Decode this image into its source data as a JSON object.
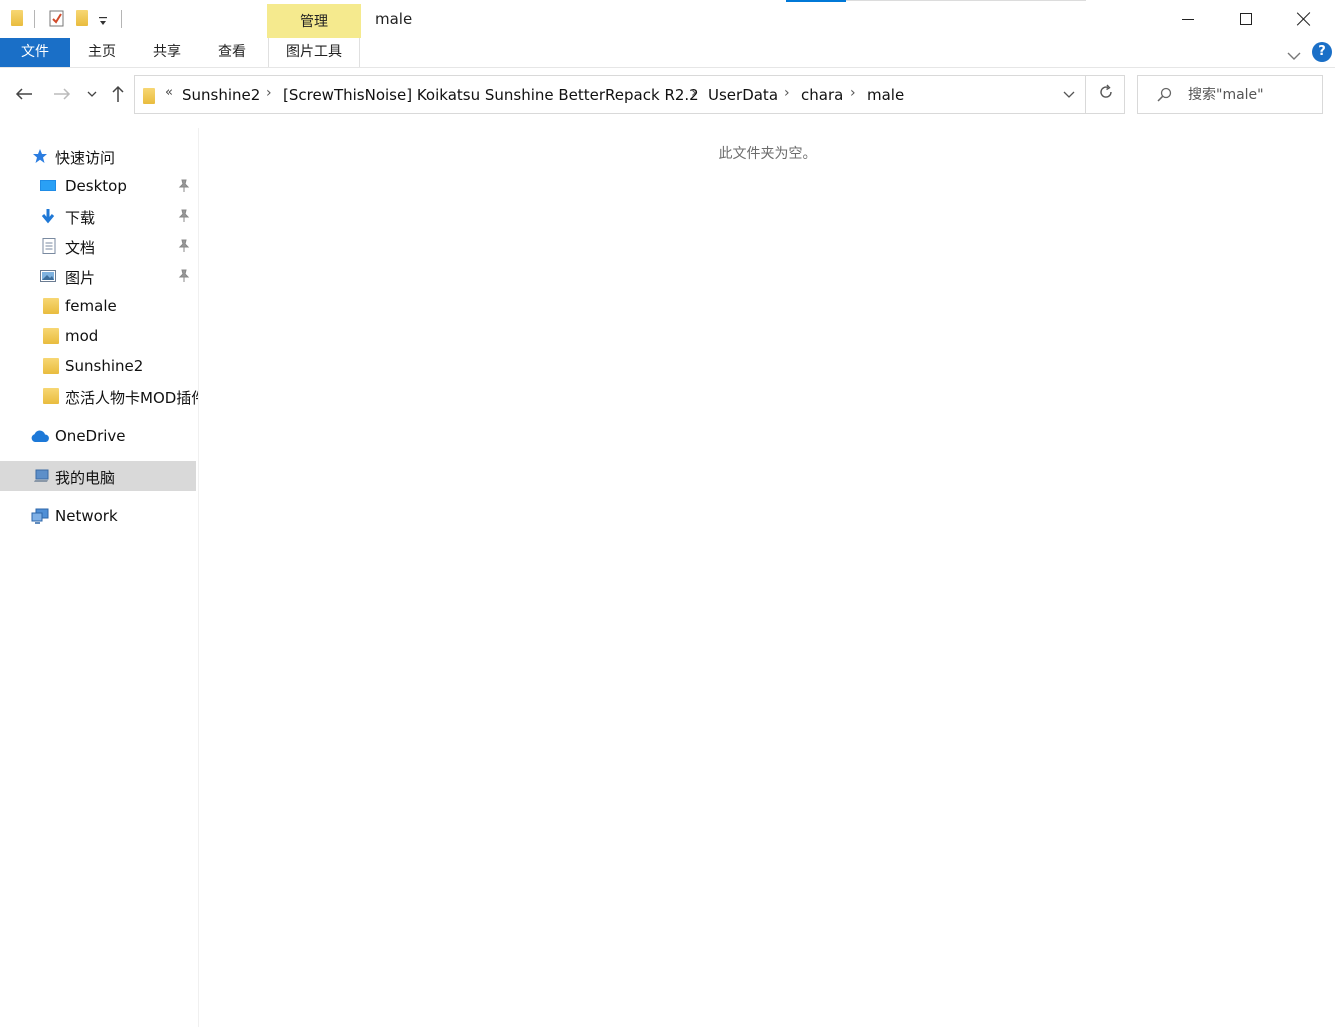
{
  "window": {
    "title": "male",
    "manage_tab": "管理"
  },
  "ribbon": {
    "file": "文件",
    "home": "主页",
    "share": "共享",
    "view": "查看",
    "picture_tools": "图片工具",
    "help": "?"
  },
  "address": {
    "overflow": "«",
    "crumbs": [
      "Sunshine2",
      "[ScrewThisNoise] Koikatsu Sunshine BetterRepack R2.2",
      "UserData",
      "chara",
      "male"
    ]
  },
  "search": {
    "placeholder": "搜索\"male\""
  },
  "sidebar": {
    "quick_access": "快速访问",
    "items": [
      {
        "label": "Desktop",
        "icon": "desktop-icon",
        "pinned": true
      },
      {
        "label": "下载",
        "icon": "download-icon",
        "pinned": true
      },
      {
        "label": "文档",
        "icon": "document-icon",
        "pinned": true
      },
      {
        "label": "图片",
        "icon": "pictures-icon",
        "pinned": true
      },
      {
        "label": "female",
        "icon": "folder-icon",
        "pinned": false
      },
      {
        "label": "mod",
        "icon": "folder-icon",
        "pinned": false
      },
      {
        "label": "Sunshine2",
        "icon": "folder-icon",
        "pinned": false
      },
      {
        "label": "恋活人物卡MOD插件",
        "icon": "folder-icon",
        "pinned": false
      }
    ],
    "onedrive": "OneDrive",
    "this_pc": "我的电脑",
    "network": "Network"
  },
  "content": {
    "empty_message": "此文件夹为空。"
  },
  "colors": {
    "accent": "#1a6fc7",
    "manage_tab": "#f5ea8e",
    "selected": "#d9d9d9"
  }
}
